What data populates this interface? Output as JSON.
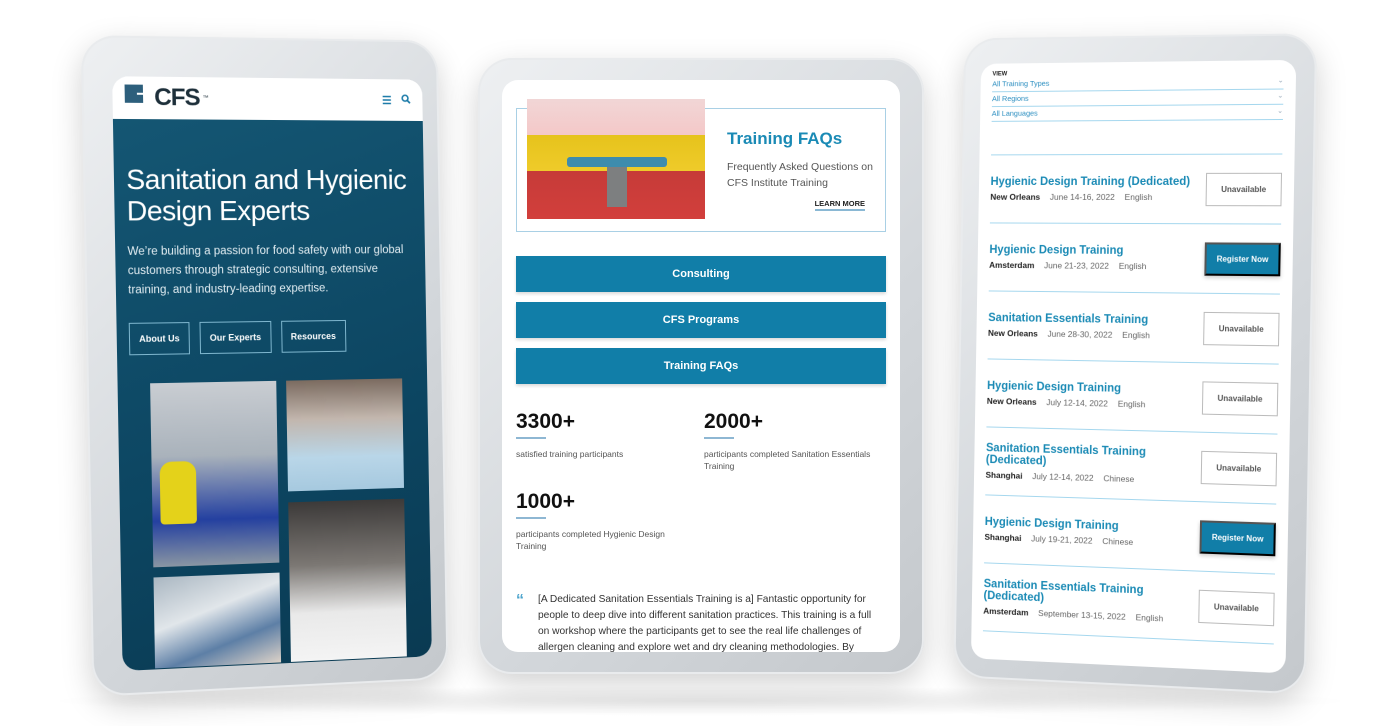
{
  "left_device": {
    "brand": "CFS",
    "brand_mark": "™",
    "header_icons": [
      "menu-icon",
      "search-icon"
    ],
    "hero_title": "Sanitation and Hygienic Design Experts",
    "hero_text": "We’re building a passion for food safety with our global customers through strategic consulting, extensive training, and industry-leading expertise.",
    "buttons": [
      "About Us",
      "Our Experts",
      "Resources"
    ],
    "photos": [
      "worker-in-yellow-suit-at-conveyor",
      "family-dinner-table",
      "inspector-with-flashlight",
      "engineer-with-white-model"
    ]
  },
  "middle_device": {
    "faq_card": {
      "title": "Training FAQs",
      "description": "Frequently Asked Questions on CFS Institute Training",
      "link": "LEARN MORE"
    },
    "nav_buttons": [
      "Consulting",
      "CFS Programs",
      "Training FAQs"
    ],
    "stats": [
      {
        "value": "3300+",
        "label": "satisfied training participants"
      },
      {
        "value": "2000+",
        "label": "participants completed Sanitation Essentials Training"
      },
      {
        "value": "1000+",
        "label": "participants completed Hygienic Design Training"
      }
    ],
    "quote": "[A Dedicated Sanitation Essentials Training is a] Fantastic opportunity for people to deep dive into different sanitation practices. This training is a full on workshop where the participants get to see the real life challenges of allergen cleaning and explore wet and dry cleaning methodologies. By"
  },
  "right_device": {
    "view_label": "VIEW",
    "filters": [
      "All Training Types",
      "All Regions",
      "All Languages"
    ],
    "events": [
      {
        "title": "Hygienic Design Training (Dedicated)",
        "location": "New Orleans",
        "date": "June 14-16, 2022",
        "language": "English",
        "action": "Unavailable",
        "status": "unavailable"
      },
      {
        "title": "Hygienic Design Training",
        "location": "Amsterdam",
        "date": "June 21-23, 2022",
        "language": "English",
        "action": "Register Now",
        "status": "register"
      },
      {
        "title": "Sanitation Essentials Training",
        "location": "New Orleans",
        "date": "June 28-30, 2022",
        "language": "English",
        "action": "Unavailable",
        "status": "unavailable"
      },
      {
        "title": "Hygienic Design Training",
        "location": "New Orleans",
        "date": "July 12-14, 2022",
        "language": "English",
        "action": "Unavailable",
        "status": "unavailable"
      },
      {
        "title": "Sanitation Essentials Training (Dedicated)",
        "location": "Shanghai",
        "date": "July 12-14, 2022",
        "language": "Chinese",
        "action": "Unavailable",
        "status": "unavailable"
      },
      {
        "title": "Hygienic Design Training",
        "location": "Shanghai",
        "date": "July 19-21, 2022",
        "language": "Chinese",
        "action": "Register Now",
        "status": "register"
      },
      {
        "title": "Sanitation Essentials Training (Dedicated)",
        "location": "Amsterdam",
        "date": "September 13-15, 2022",
        "language": "English",
        "action": "Unavailable",
        "status": "unavailable"
      }
    ]
  },
  "colors": {
    "brand_teal": "#0c4561",
    "accent_blue": "#117ea8",
    "link_blue": "#1a8ab5",
    "divider": "#a5d7ee"
  }
}
